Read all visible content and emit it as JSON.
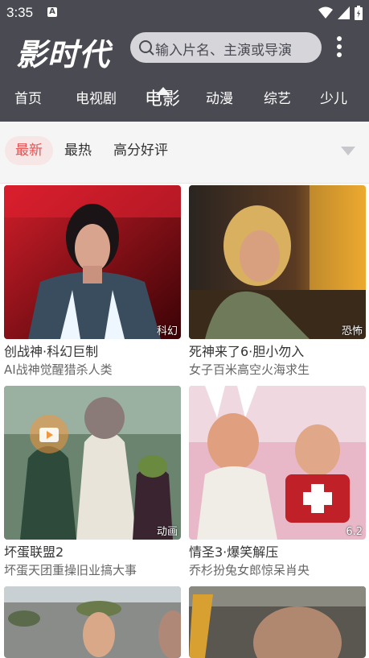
{
  "status": {
    "time": "3:35",
    "notify_icon": "A"
  },
  "header": {
    "logo": "影时代",
    "search_placeholder": "输入片名、主演或导演"
  },
  "tabs": [
    "首页",
    "电视剧",
    "电影",
    "动漫",
    "综艺",
    "少儿"
  ],
  "active_tab": "电影",
  "filters": [
    "最新",
    "最热",
    "高分好评"
  ],
  "active_filter": "最新",
  "cards": [
    {
      "title": "创战神·科幻巨制",
      "sub": "AI战神觉醒猎杀人类",
      "tag": "科幻"
    },
    {
      "title": "死神来了6·胆小勿入",
      "sub": "女子百米高空火海求生",
      "tag": "恐怖"
    },
    {
      "title": "坏蛋联盟2",
      "sub": "坏蛋天团重操旧业搞大事",
      "tag": "动画"
    },
    {
      "title": "情圣3·爆笑解压",
      "sub": "乔杉扮兔女郎惊呆肖央",
      "tag": "6.2"
    }
  ],
  "colors": {
    "header_bg": "#4a4a52",
    "accent": "#e05555",
    "filter_bg": "#f5f5f5"
  }
}
